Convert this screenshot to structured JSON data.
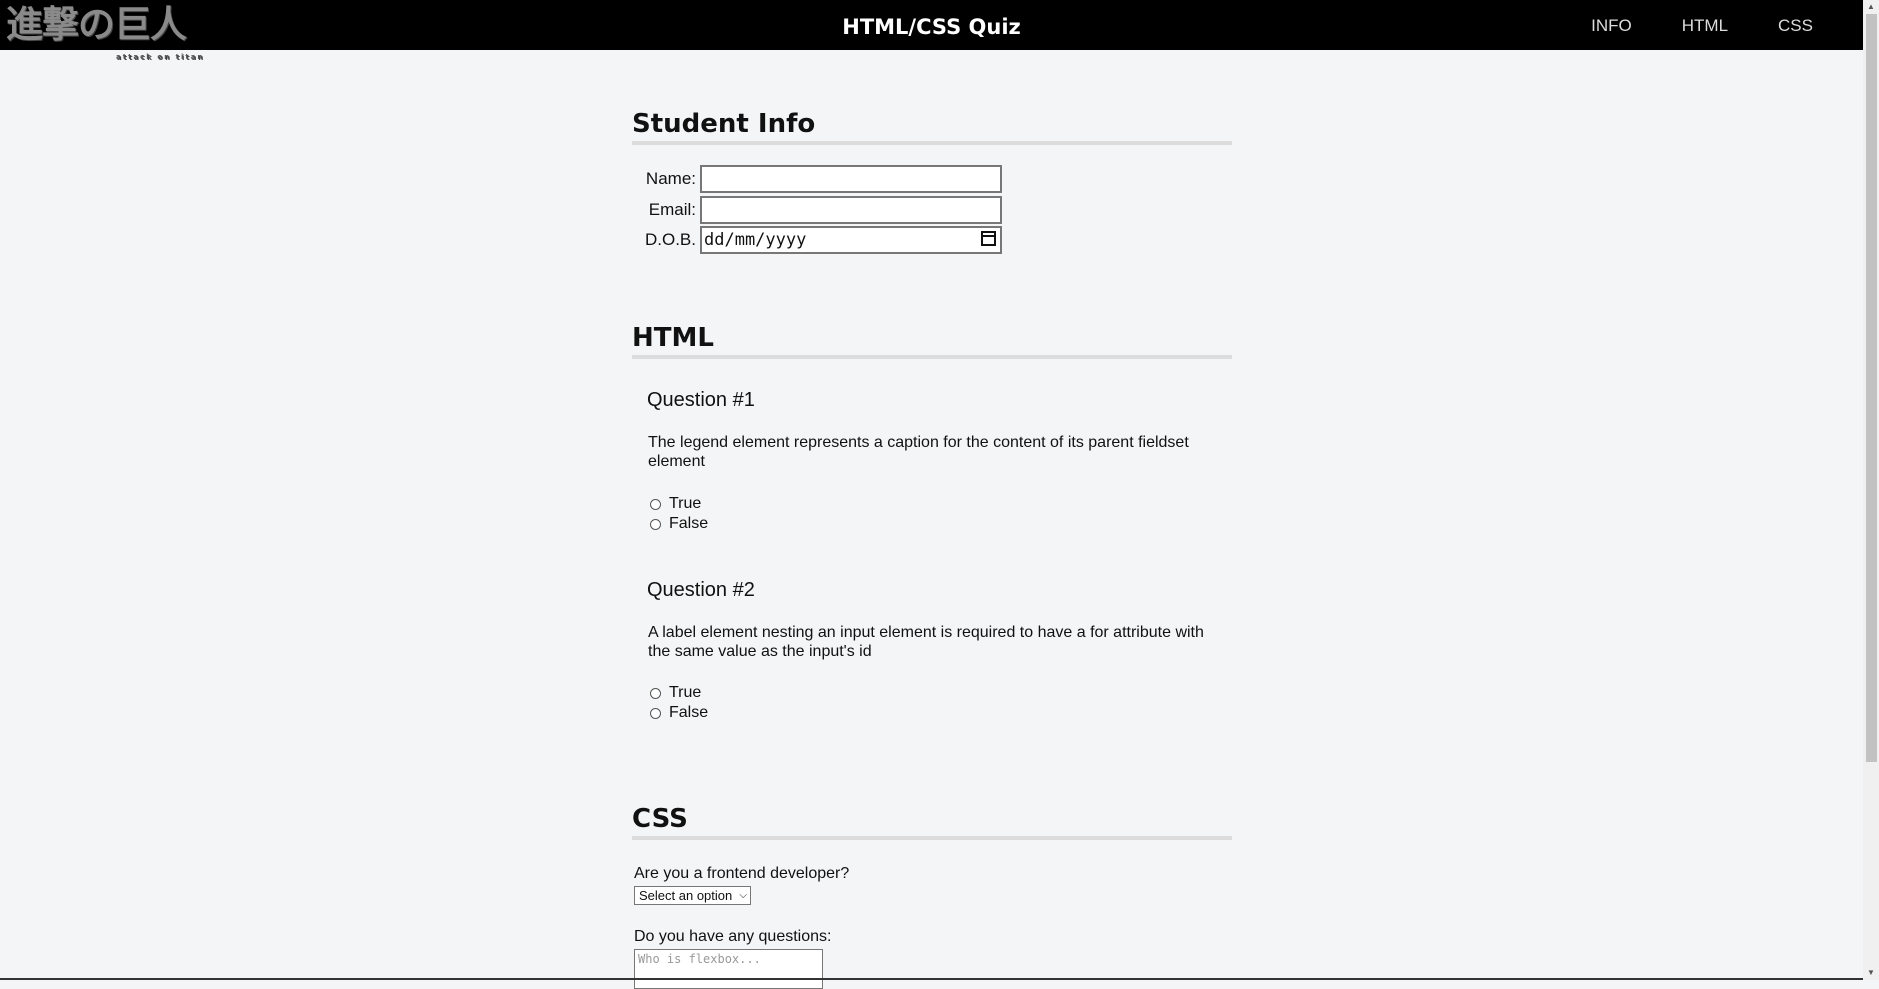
{
  "header": {
    "logo_text": "進撃の巨人",
    "logo_subtext": "attack on titan",
    "title": "HTML/CSS Quiz",
    "nav": [
      "INFO",
      "HTML",
      "CSS"
    ]
  },
  "student_info": {
    "heading": "Student Info",
    "fields": {
      "name_label": "Name:",
      "email_label": "Email:",
      "dob_label": "D.O.B.",
      "dob_placeholder": "dd/mm/yyyy"
    }
  },
  "html_section": {
    "heading": "HTML",
    "questions": [
      {
        "title": "Question #1",
        "text": "The legend element represents a caption for the content of its parent fieldset element",
        "options": [
          "True",
          "False"
        ]
      },
      {
        "title": "Question #2",
        "text": "A label element nesting an input element is required to have a for attribute with the same value as the input's id",
        "options": [
          "True",
          "False"
        ]
      }
    ]
  },
  "css_section": {
    "heading": "CSS",
    "frontend_question": "Are you a frontend developer?",
    "select_value": "Select an option",
    "questions_label": "Do you have any questions:",
    "textarea_placeholder": "Who is flexbox..."
  }
}
